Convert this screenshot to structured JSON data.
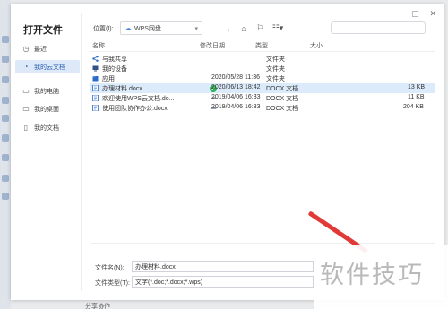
{
  "dialog": {
    "title": "打开文件",
    "topright_icons": [
      "restore-icon",
      "close-icon"
    ],
    "nav": [
      {
        "label": "最近",
        "icon": "clock-icon"
      },
      {
        "label": "我的云文档",
        "icon": "cloud-doc-icon",
        "active": true
      },
      {
        "label": "我的电脑",
        "icon": "computer-icon"
      },
      {
        "label": "我的桌面",
        "icon": "desktop-icon"
      },
      {
        "label": "我的文档",
        "icon": "documents-icon"
      }
    ]
  },
  "toolbar": {
    "location_label": "位置(I):",
    "location_value": "WPS网盘",
    "icons": [
      "back-arrow-icon",
      "forward-arrow-icon",
      "up-folder-icon",
      "new-folder-icon",
      "view-mode-icon"
    ]
  },
  "columns": {
    "name": "名称",
    "modified": "修改日期",
    "type": "类型",
    "size": "大小"
  },
  "files": [
    {
      "name": "与我共享",
      "modified": "",
      "type": "文件夹",
      "size": "",
      "icon": "share-icon"
    },
    {
      "name": "我的设备",
      "modified": "",
      "type": "文件夹",
      "size": "",
      "icon": "device-icon"
    },
    {
      "name": "应用",
      "modified": "2020/05/28 11:36",
      "type": "文件夹",
      "size": "",
      "icon": "folder-icon"
    },
    {
      "name": "办理材料.docx",
      "modified": "2020/06/13 18:42",
      "type": "DOCX 文档",
      "size": "13 KB",
      "icon": "docx-icon",
      "status": "synced",
      "selected": true
    },
    {
      "name": "欢迎使用WPS云文档.do...",
      "modified": "2019/04/06 16:33",
      "type": "DOCX 文档",
      "size": "11 KB",
      "icon": "docx-icon",
      "status": "cloud"
    },
    {
      "name": "使用团队协作办公.docx",
      "modified": "2019/04/06 16:33",
      "type": "DOCX 文档",
      "size": "204 KB",
      "icon": "docx-icon",
      "status": "cloud"
    }
  ],
  "footer": {
    "filename_label": "文件名(N):",
    "filename_value": "办理材料.docx",
    "filetype_label": "文件类型(T):",
    "filetype_value": "文字(*.doc;*.docx;*.wps)"
  },
  "watermark": "软件技巧",
  "background_partial_text": "分享协作",
  "colors": {
    "accent": "#2b5fb0",
    "selected_row": "#dcebfb",
    "synced": "#2fb15a",
    "arrow": "#e13a36"
  }
}
